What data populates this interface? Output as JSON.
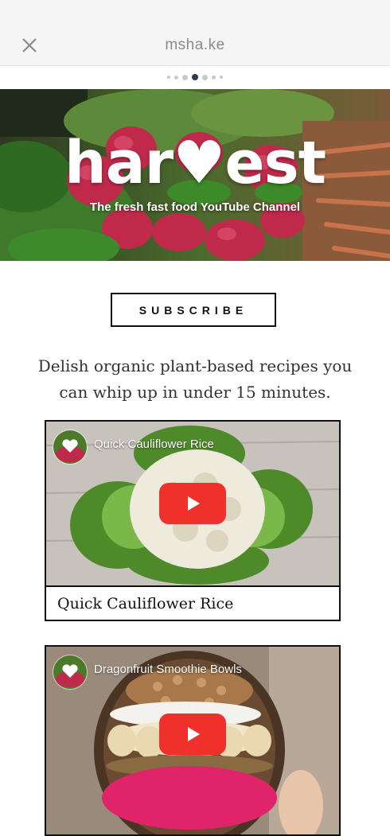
{
  "topbar": {
    "title": "msha.ke",
    "close_icon": "close-icon"
  },
  "pager": {
    "dot_count": 7,
    "active_index": 3
  },
  "banner": {
    "logo_text": "har♥est",
    "tagline": "The fresh fast food YouTube Channel"
  },
  "subscribe": {
    "label": "SUBSCRIBE"
  },
  "description": "Delish organic plant-based recipes you can whip up in under 15 minutes.",
  "videos": [
    {
      "overlay_title": "Quick Cauliflower Rice",
      "caption": "Quick Cauliflower Rice",
      "play_icon": "youtube-play-icon"
    },
    {
      "overlay_title": "Dragonfruit Smoothie Bowls",
      "caption": "",
      "play_icon": "youtube-play-icon"
    }
  ],
  "colors": {
    "play_button": "#f0302b",
    "active_dot": "#2f3a4a"
  }
}
